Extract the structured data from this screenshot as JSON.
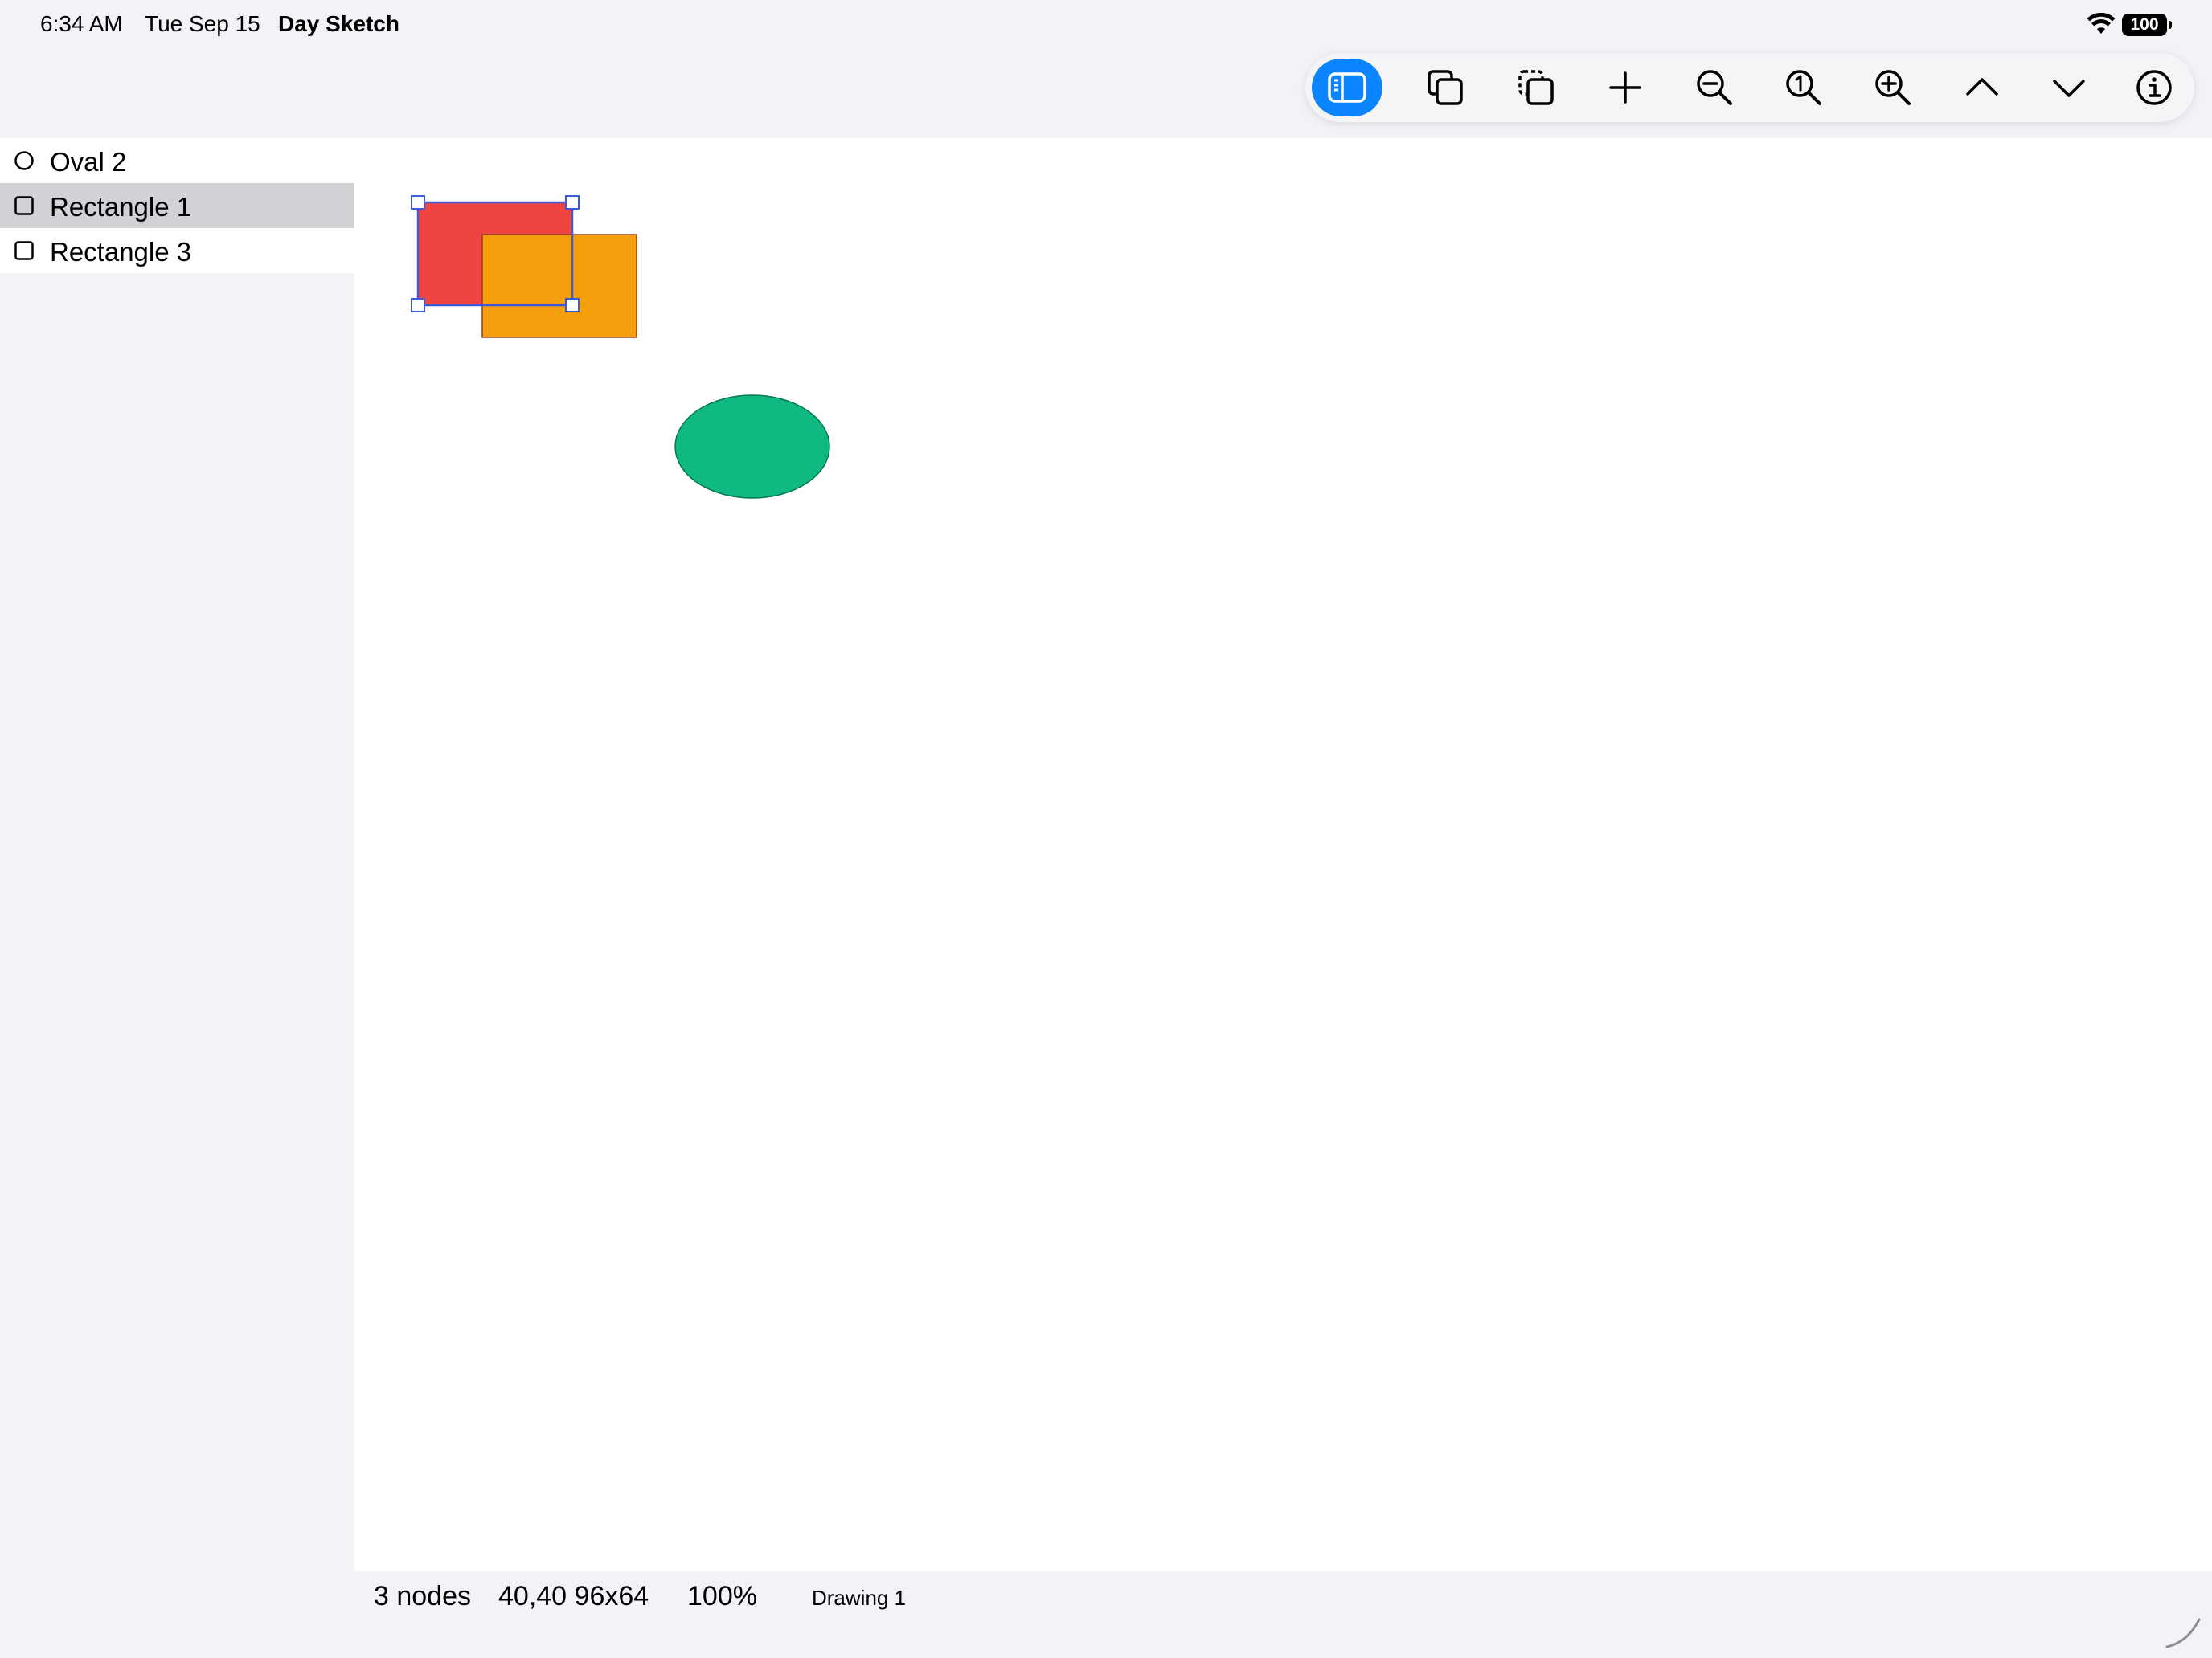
{
  "status_bar": {
    "time": "6:34 AM",
    "date": "Tue Sep 15",
    "app_name": "Day Sketch",
    "battery_level": "100",
    "wifi_icon": "wifi-icon"
  },
  "toolbar": {
    "buttons": [
      {
        "name": "toggle-sidebar",
        "icon": "sidebar-icon",
        "active": true
      },
      {
        "name": "duplicate",
        "icon": "duplicate-icon"
      },
      {
        "name": "copy-selection",
        "icon": "dashed-copy-icon"
      },
      {
        "name": "add-node",
        "icon": "plus-icon"
      },
      {
        "name": "zoom-out",
        "icon": "zoom-out-icon"
      },
      {
        "name": "actual-size",
        "icon": "zoom-actual-size-icon"
      },
      {
        "name": "zoom-in",
        "icon": "zoom-in-icon"
      },
      {
        "name": "move-up",
        "icon": "chevron-up-icon"
      },
      {
        "name": "move-down",
        "icon": "chevron-down-icon"
      },
      {
        "name": "info",
        "icon": "info-icon"
      }
    ],
    "accent_color": "#0a84ff"
  },
  "sidebar": {
    "items": [
      {
        "label": "Oval 2",
        "icon": "circle-icon",
        "selected": false
      },
      {
        "label": "Rectangle 1",
        "icon": "square-icon",
        "selected": true
      },
      {
        "label": "Rectangle 3",
        "icon": "square-icon",
        "selected": false
      }
    ]
  },
  "canvas": {
    "shapes": [
      {
        "name": "Rectangle 1",
        "kind": "rectangle",
        "fill": "#ef4444",
        "selected": true
      },
      {
        "name": "Rectangle 3",
        "kind": "rectangle",
        "fill": "#f59e0b",
        "selected": false
      },
      {
        "name": "Oval 2",
        "kind": "oval",
        "fill": "#10b981",
        "selected": false
      }
    ],
    "selection_color": "#3b5bdb"
  },
  "bottom_bar": {
    "node_count": "3 nodes",
    "selection_frame": "40,40 96x64",
    "zoom": "100%",
    "document_name": "Drawing 1"
  }
}
